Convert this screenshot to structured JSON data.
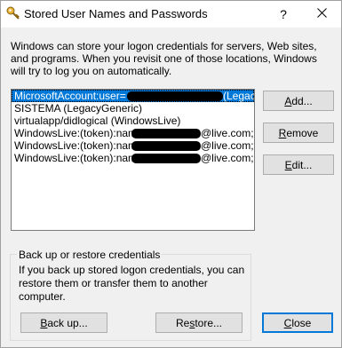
{
  "window": {
    "title": "Stored User Names and Passwords",
    "help_glyph": "?",
    "close_glyph": "✕"
  },
  "description": "Windows can store your logon credentials for servers, Web sites, and programs. When you revisit one of those locations, Windows will try to log you on automatically.",
  "credentials": [
    {
      "prefix": "MicrosoftAccount:user=",
      "suffix": " (Legac",
      "redacted": true,
      "selected": true
    },
    {
      "prefix": "SISTEMA (LegacyGeneric)",
      "suffix": "",
      "redacted": false,
      "selected": false
    },
    {
      "prefix": "virtualapp/didlogical (WindowsLive)",
      "suffix": "",
      "redacted": false,
      "selected": false
    },
    {
      "prefix": "WindowsLive:(token):name=",
      "suffix": "@live.com;",
      "redacted": true,
      "selected": false
    },
    {
      "prefix": "WindowsLive:(token):name=",
      "suffix": "@live.com;",
      "redacted": true,
      "selected": false
    },
    {
      "prefix": "WindowsLive:(token):name=",
      "suffix": "@live.com;",
      "redacted": true,
      "selected": false
    }
  ],
  "buttons": {
    "add": {
      "before": "",
      "key": "A",
      "after": "dd..."
    },
    "remove": {
      "before": "",
      "key": "R",
      "after": "emove"
    },
    "edit": {
      "before": "",
      "key": "E",
      "after": "dit..."
    },
    "backup": {
      "before": "",
      "key": "B",
      "after": "ack up..."
    },
    "restore": {
      "before": "Re",
      "key": "s",
      "after": "tore..."
    },
    "close": {
      "before": "",
      "key": "C",
      "after": "lose"
    }
  },
  "backup_group": {
    "label": "Back up or restore credentials",
    "text": "If you back up stored logon credentials, you can restore them or transfer them to another computer."
  },
  "icons": {
    "title": "key-icon"
  }
}
